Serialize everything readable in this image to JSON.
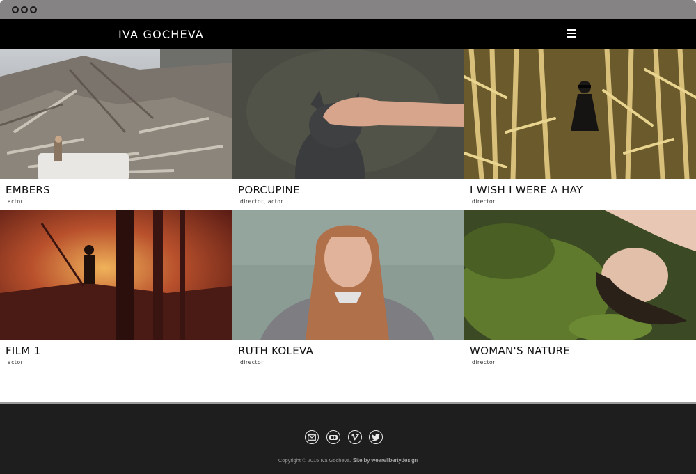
{
  "site": {
    "brand": "IVA GOCHEVA",
    "menu_icon": "hamburger-menu-icon"
  },
  "projects": [
    {
      "title": "EMBERS",
      "role": "actor"
    },
    {
      "title": "PORCUPINE",
      "role": "director, actor"
    },
    {
      "title": "I WISH I WERE A HAY",
      "role": "director"
    },
    {
      "title": "FILM 1",
      "role": "actor"
    },
    {
      "title": "RUTH KOLEVA",
      "role": "director"
    },
    {
      "title": "WOMAN'S NATURE",
      "role": "director"
    }
  ],
  "footer": {
    "social_icons": [
      "email-icon",
      "flickr-icon",
      "vimeo-icon",
      "twitter-icon"
    ],
    "copyright": "Copyright © 2015 Iva Gocheva.",
    "credit": "Site by wearelibertydesign"
  },
  "colors": {
    "header_bg": "#000000",
    "footer_bg": "#1e1e1e",
    "chrome_bg": "#858383"
  }
}
